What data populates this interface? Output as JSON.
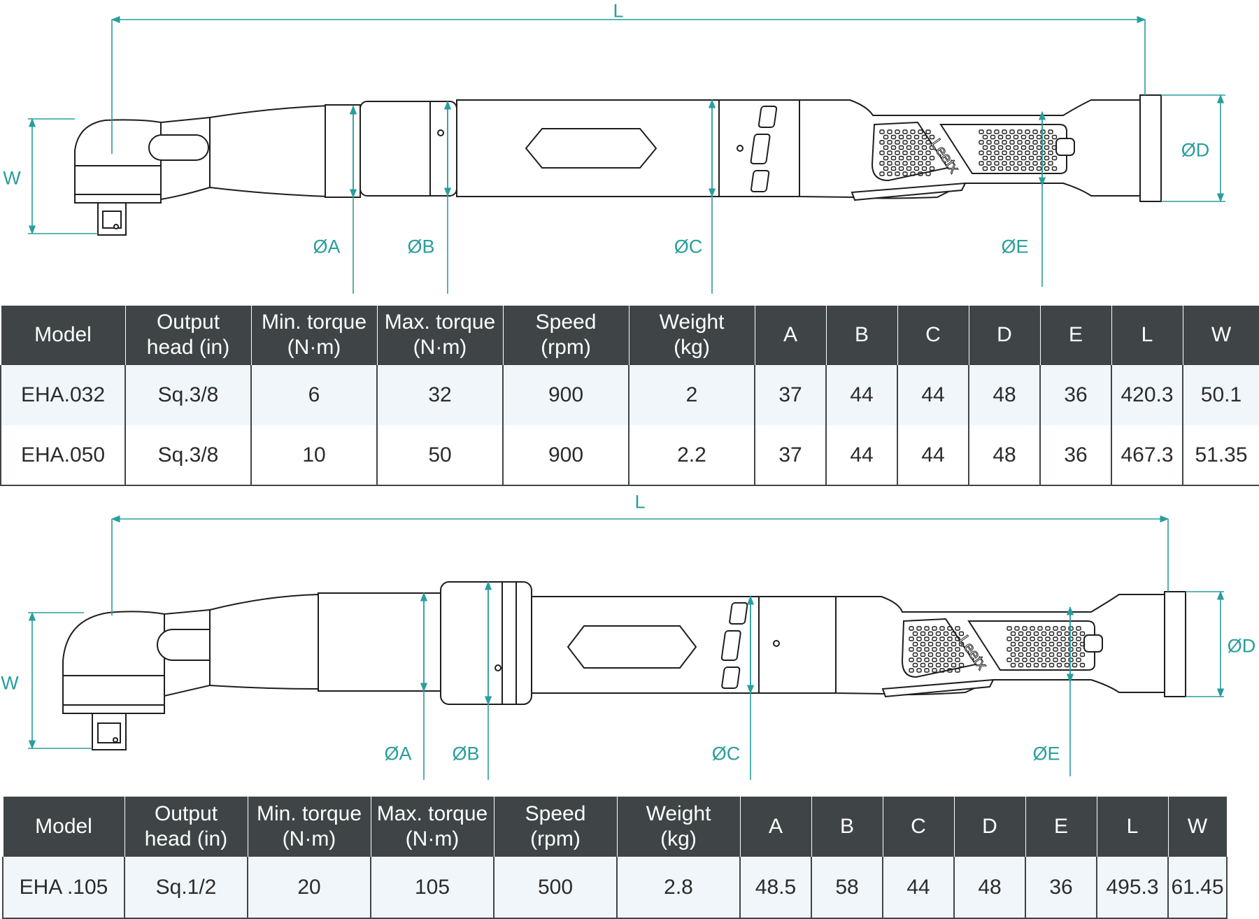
{
  "diagram1": {
    "labels": {
      "L": "L",
      "W": "W",
      "D": "ØD",
      "A": "ØA",
      "B": "ØB",
      "C": "ØC",
      "E": "ØE"
    },
    "brand": "Leetx"
  },
  "diagram2": {
    "labels": {
      "L": "L",
      "W": "W",
      "D": "ØD",
      "A": "ØA",
      "B": "ØB",
      "C": "ØC",
      "E": "ØE"
    },
    "brand": "Leetx"
  },
  "colors": {
    "dimension": "#2a9d9d",
    "header": "#3f4546",
    "rowAlt": "#f1f6fb",
    "outline": "#1e1e1e"
  },
  "table1": {
    "headers": [
      [
        "Model"
      ],
      [
        "Output",
        "head (in)"
      ],
      [
        "Min. torque",
        "(N·m)"
      ],
      [
        "Max. torque",
        "(N·m)"
      ],
      [
        "Speed",
        "(rpm)"
      ],
      [
        "Weight",
        "(kg)"
      ],
      [
        "A"
      ],
      [
        "B"
      ],
      [
        "C"
      ],
      [
        "D"
      ],
      [
        "E"
      ],
      [
        "L"
      ],
      [
        "W"
      ]
    ],
    "rows": [
      [
        "EHA.032",
        "Sq.3/8",
        "6",
        "32",
        "900",
        "2",
        "37",
        "44",
        "44",
        "48",
        "36",
        "420.3",
        "50.1"
      ],
      [
        "EHA.050",
        "Sq.3/8",
        "10",
        "50",
        "900",
        "2.2",
        "37",
        "44",
        "44",
        "48",
        "36",
        "467.3",
        "51.35"
      ]
    ]
  },
  "table2": {
    "headers": [
      [
        "Model"
      ],
      [
        "Output",
        "head (in)"
      ],
      [
        "Min. torque",
        "(N·m)"
      ],
      [
        "Max. torque",
        "(N·m)"
      ],
      [
        "Speed",
        "(rpm)"
      ],
      [
        "Weight",
        "(kg)"
      ],
      [
        "A"
      ],
      [
        "B"
      ],
      [
        "C"
      ],
      [
        "D"
      ],
      [
        "E"
      ],
      [
        "L"
      ],
      [
        "W"
      ]
    ],
    "rows": [
      [
        "EHA .105",
        "Sq.1/2",
        "20",
        "105",
        "500",
        "2.8",
        "48.5",
        "58",
        "44",
        "48",
        "36",
        "495.3",
        "61.45"
      ]
    ]
  }
}
